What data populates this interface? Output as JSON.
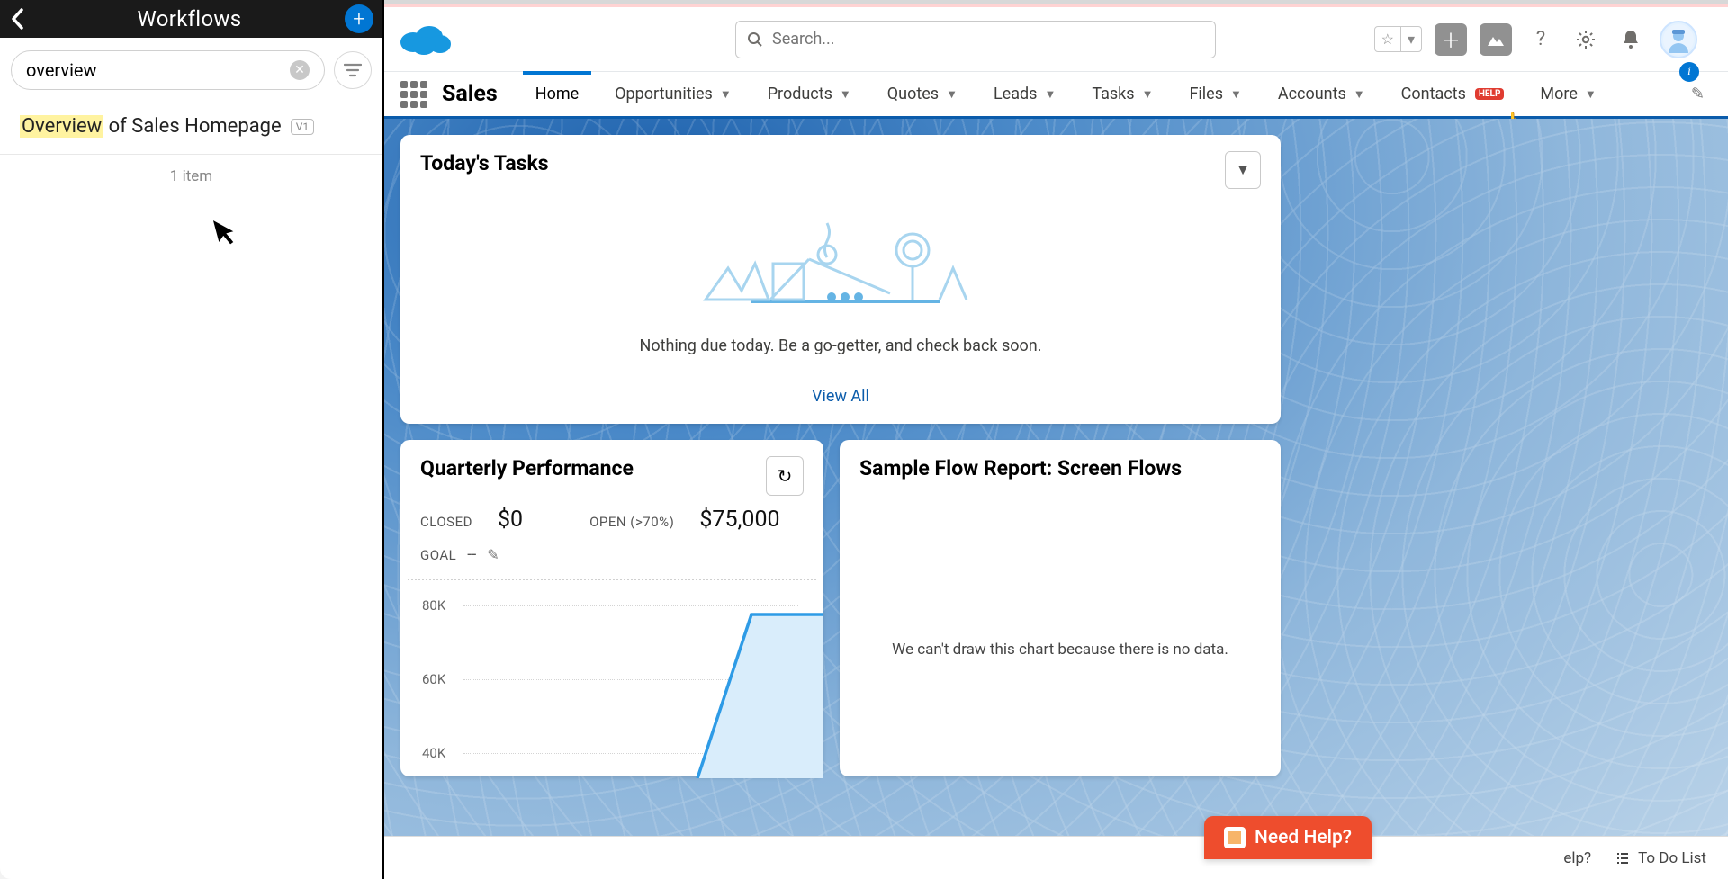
{
  "sidebar": {
    "title": "Workflows",
    "search_value": "overview",
    "result": {
      "highlight": "Overview",
      "rest": " of Sales Homepage",
      "version": "V1"
    },
    "count_label": "1 item"
  },
  "header": {
    "search_placeholder": "Search..."
  },
  "nav": {
    "app": "Sales",
    "items": [
      {
        "label": "Home",
        "active": true,
        "dropdown": false
      },
      {
        "label": "Opportunities",
        "dropdown": true
      },
      {
        "label": "Products",
        "dropdown": true
      },
      {
        "label": "Quotes",
        "dropdown": true
      },
      {
        "label": "Leads",
        "dropdown": true
      },
      {
        "label": "Tasks",
        "dropdown": true
      },
      {
        "label": "Files",
        "dropdown": true
      },
      {
        "label": "Accounts",
        "dropdown": true
      },
      {
        "label": "Contacts",
        "dropdown": true,
        "help": true
      },
      {
        "label": "More",
        "dropdown": true
      }
    ]
  },
  "tasks": {
    "title": "Today's Tasks",
    "empty_text": "Nothing due today. Be a go-getter, and check back soon.",
    "view_all": "View All"
  },
  "qp": {
    "title": "Quarterly Performance",
    "closed_label": "CLOSED",
    "closed_value": "$0",
    "open_label": "OPEN (>70%)",
    "open_value": "$75,000",
    "goal_label": "GOAL",
    "goal_value": "--"
  },
  "sf": {
    "title": "Sample Flow Report: Screen Flows",
    "no_data": "We can't draw this chart because there is no data."
  },
  "footer": {
    "need_help": "Need Help?",
    "help": "elp?",
    "todo": "To Do List"
  },
  "chart_data": {
    "type": "area",
    "title": "Quarterly Performance",
    "ylabel": "",
    "y_ticks": [
      "40K",
      "60K",
      "80K"
    ],
    "ylim": [
      0,
      80000
    ],
    "series": [
      {
        "name": "Open (>70%)",
        "values": [
          0,
          0,
          0,
          75000,
          75000
        ]
      }
    ],
    "note": "x-axis categories not visible in crop; only partial right segment rises to ~75K then plateaus"
  }
}
